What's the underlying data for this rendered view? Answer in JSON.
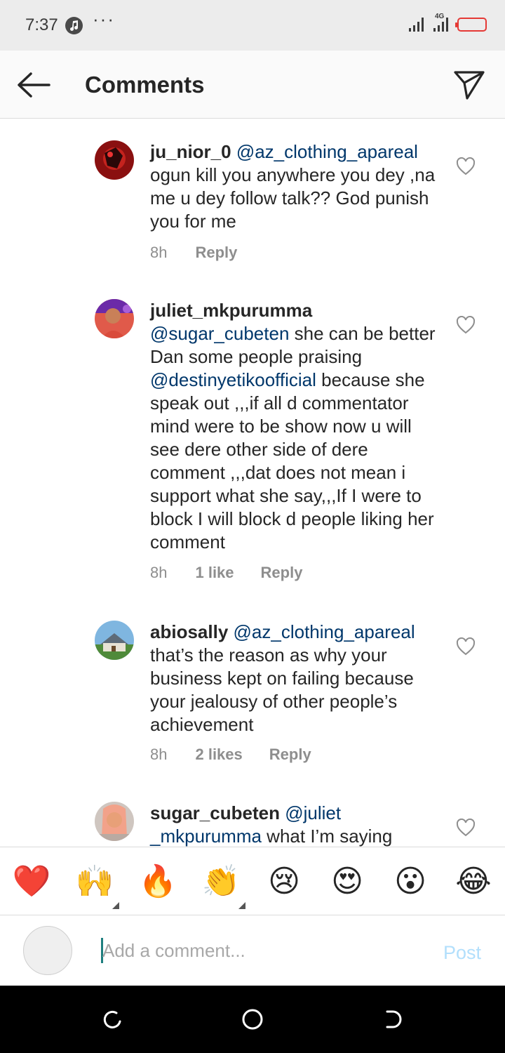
{
  "status_bar": {
    "time": "7:37",
    "network": "4G",
    "icons": [
      "music-note-icon",
      "more-dots-icon",
      "signal-icon",
      "battery-icon"
    ],
    "battery_color": "#e53935"
  },
  "header": {
    "title": "Comments",
    "icons": [
      "back-arrow-icon",
      "direct-share-icon"
    ]
  },
  "comments": [
    {
      "username": "ju_nior_0",
      "mention": "@az_clothing_apareal",
      "text": "ogun kill you anywhere you dey ,na me u dey follow talk?? God punish you for me",
      "time": "8h",
      "likes": "",
      "reply": "Reply"
    },
    {
      "username": "juliet_mkpurumma",
      "mention": "@sugar_cubeten",
      "text_a": "she can be better Dan some people praising",
      "mention2": "@destinyetikoofficial",
      "text_b": "because she speak out ,,,if all d commentator mind were to be show now u will see dere other side of dere comment ,,,dat does not mean i support what she say,,,If I were to block I will block d people liking her comment",
      "time": "8h",
      "likes": "1 like",
      "reply": "Reply"
    },
    {
      "username": "abiosally",
      "mention": "@az_clothing_apareal",
      "text": "that’s the reason as why your business kept on failing because your  jealousy of other people’s achievement",
      "time": "8h",
      "likes": "2 likes",
      "reply": "Reply"
    },
    {
      "username": "sugar_cubeten",
      "mention": "@juliet _mkpurumma",
      "text": "what I’m saying",
      "time": "",
      "likes": "",
      "reply": ""
    }
  ],
  "emoji_bar": {
    "emojis": [
      "❤️",
      "🙌",
      "🔥",
      "👏",
      "😢",
      "😍",
      "😮",
      "😂"
    ]
  },
  "composer": {
    "placeholder": "Add a comment...",
    "value": "",
    "post_label": "Post",
    "post_color": "#b2dffc"
  },
  "nav_bar": {
    "icons": [
      "recent-apps-icon",
      "home-icon",
      "back-icon"
    ]
  }
}
